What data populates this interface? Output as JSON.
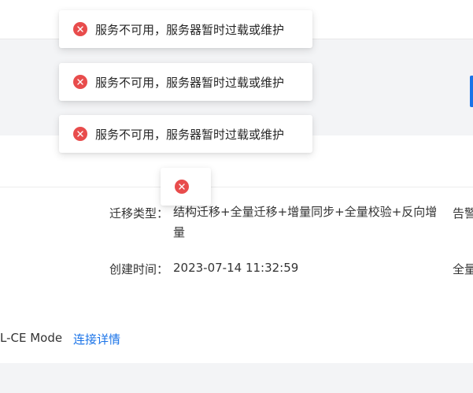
{
  "toasts": [
    {
      "icon": "error-icon",
      "message": "服务不可用，服务器暂时过载或维护"
    },
    {
      "icon": "error-icon",
      "message": "服务不可用，服务器暂时过载或维护"
    },
    {
      "icon": "error-icon",
      "message": "服务不可用，服务器暂时过载或维护"
    },
    {
      "icon": "error-icon",
      "message": ""
    }
  ],
  "details": {
    "migration_type_label": "迁移类型：",
    "migration_type_value": "结构迁移+全量迁移+增量同步+全量校验+反向增量",
    "migration_type_right": "告警",
    "created_time_label": "创建时间：",
    "created_time_value": "2023-07-14 11:32:59",
    "created_time_right": "全量"
  },
  "connection": {
    "mode_text": "L-CE Mode",
    "details_link": "连接详情"
  },
  "colors": {
    "error": "#e84c4c",
    "link": "#1a73e8",
    "band": "#f3f4f6"
  }
}
